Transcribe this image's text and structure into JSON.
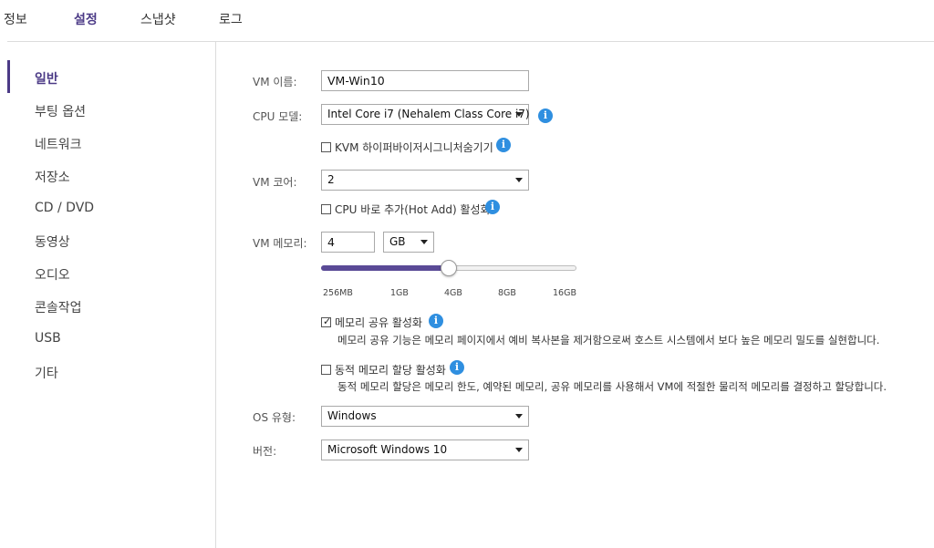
{
  "top_tabs": [
    {
      "label": "정보"
    },
    {
      "label": "설정"
    },
    {
      "label": "스냅샷"
    },
    {
      "label": "로그"
    }
  ],
  "active_tab": "설정",
  "sidebar": {
    "items": [
      {
        "label": "일반"
      },
      {
        "label": "부팅 옵션"
      },
      {
        "label": "네트워크"
      },
      {
        "label": "저장소"
      },
      {
        "label": "CD / DVD"
      },
      {
        "label": "동영상"
      },
      {
        "label": "오디오"
      },
      {
        "label": "콘솔작업"
      },
      {
        "label": "USB"
      },
      {
        "label": "기타"
      }
    ],
    "active": "일반"
  },
  "form": {
    "vm_name": {
      "label": "VM 이름:",
      "value": "VM-Win10"
    },
    "cpu_model": {
      "label": "CPU 모델:",
      "value": "Intel Core i7 (Nehalem Class Core i7)"
    },
    "kvm_hypervisor": {
      "label": "KVM 하이퍼바이저시그니처숨기기",
      "checked": false
    },
    "vm_cores": {
      "label": "VM 코어:",
      "value": "2"
    },
    "cpu_hot_add": {
      "label": "CPU 바로 추가(Hot Add) 활성화",
      "checked": false
    },
    "vm_memory": {
      "label": "VM 메모리:",
      "value": "4",
      "unit": "GB",
      "slider_level": 0.5,
      "ticks": [
        "256MB",
        "1GB",
        "4GB",
        "8GB",
        "16GB"
      ]
    },
    "memory_sharing": {
      "label": "메모리 공유 활성화",
      "checked": true,
      "description": "메모리 공유 기능은 메모리 페이지에서 예비 복사본을 제거함으로써 호스트 시스템에서 보다 높은 메모리 밀도를 실현합니다."
    },
    "dynamic_memory": {
      "label": "동적 메모리 할당 활성화",
      "checked": false,
      "description": "동적 메모리 할당은 메모리 한도, 예약된 메모리, 공유 메모리를 사용해서 VM에 적절한 물리적 메모리를 결정하고 할당합니다."
    },
    "os_type": {
      "label": "OS 유형:",
      "value": "Windows"
    },
    "version": {
      "label": "버전:",
      "value": "Microsoft Windows 10"
    }
  },
  "icons": {
    "info": "info-icon",
    "check": "checkmark-icon",
    "dropdown": "chevron-down-icon"
  },
  "colors": {
    "accent": "#4b3a86",
    "info": "#2f8fe0",
    "slider_fill": "#5a4a96"
  }
}
